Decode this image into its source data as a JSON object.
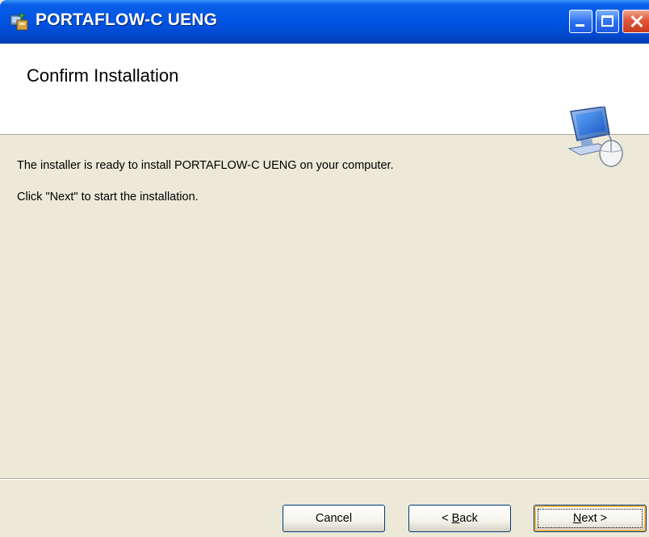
{
  "window": {
    "title": "PORTAFLOW-C UENG",
    "controls": [
      "minimize-icon",
      "maximize-icon",
      "close-icon"
    ]
  },
  "header": {
    "title": "Confirm Installation",
    "icon": "computer-mouse-icon"
  },
  "content": {
    "paragraphs": [
      "The installer is ready to install PORTAFLOW-C UENG on your computer.",
      "Click \"Next\" to start the installation."
    ]
  },
  "buttons": {
    "cancel": "Cancel",
    "back_prefix": "< ",
    "back_hotkey": "B",
    "back_rest": "ack",
    "next_hotkey": "N",
    "next_rest": "ext >"
  },
  "colors": {
    "titlebar": "#0055E5",
    "body": "#ECE9D8",
    "header": "#FFFFFF"
  }
}
